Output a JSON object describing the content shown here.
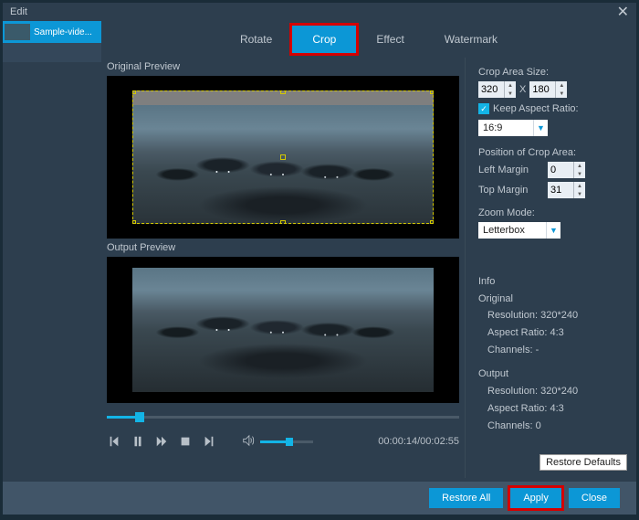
{
  "titlebar": {
    "title": "Edit",
    "close": "✕"
  },
  "sidebar": {
    "thumb_label": "Sample-vide..."
  },
  "tabs": {
    "rotate": "Rotate",
    "crop": "Crop",
    "effect": "Effect",
    "watermark": "Watermark"
  },
  "previews": {
    "original_label": "Original Preview",
    "output_label": "Output Preview"
  },
  "controls": {
    "time": "00:00:14/00:02:55"
  },
  "panel": {
    "crop_size_label": "Crop Area Size:",
    "width": "320",
    "x": "X",
    "height": "180",
    "keep_ratio": "Keep Aspect Ratio:",
    "ratio_value": "16:9",
    "position_label": "Position of Crop Area:",
    "left_margin_label": "Left Margin",
    "left_margin": "0",
    "top_margin_label": "Top Margin",
    "top_margin": "31",
    "zoom_label": "Zoom Mode:",
    "zoom_value": "Letterbox",
    "info_label": "Info",
    "original_label": "Original",
    "original_res": "Resolution: 320*240",
    "original_ar": "Aspect Ratio: 4:3",
    "original_ch": "Channels: -",
    "output_label": "Output",
    "output_res": "Resolution: 320*240",
    "output_ar": "Aspect Ratio: 4:3",
    "output_ch": "Channels: 0",
    "restore_defaults": "Restore Defaults"
  },
  "footer": {
    "restore_all": "Restore All",
    "apply": "Apply",
    "close": "Close"
  }
}
